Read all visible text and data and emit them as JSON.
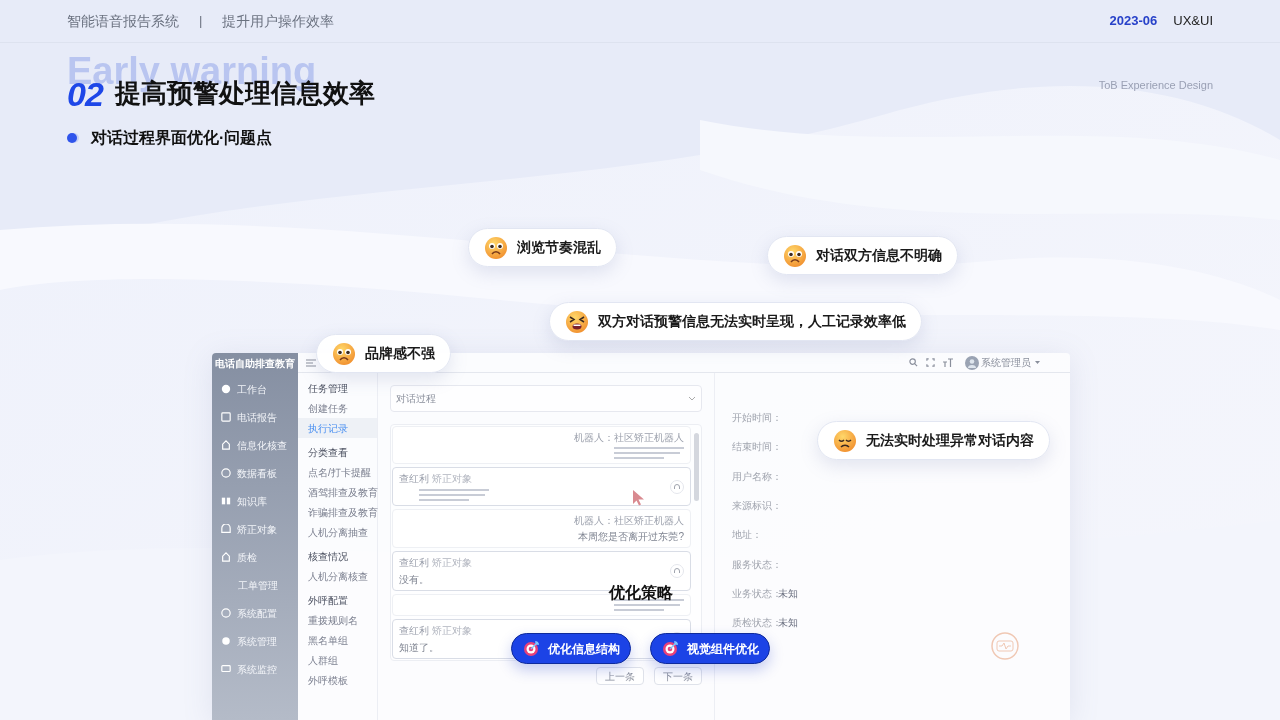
{
  "header": {
    "project": "智能语音报告系统",
    "separator": "|",
    "topic": "提升用户操作效率",
    "date": "2023-06",
    "tag": "UX&UI"
  },
  "section": {
    "number": "02",
    "ghost": "Early warning",
    "title": "提高预警处理信息效率",
    "subtitle": "对话过程界面优化·问题点",
    "tagline": "ToB Experience Design"
  },
  "app": {
    "brand": "电话自助排查教育",
    "sidebar": [
      {
        "label": "工作台",
        "selected": false
      },
      {
        "label": "电话报告",
        "selected": false
      },
      {
        "label": "信息化核查",
        "selected": false
      },
      {
        "label": "数据看板",
        "selected": false
      },
      {
        "label": "知识库",
        "selected": false
      },
      {
        "label": "矫正对象",
        "selected": false
      },
      {
        "label": "质检",
        "selected": false,
        "children": [
          {
            "label": "工单管理",
            "selected": false
          }
        ]
      },
      {
        "label": "系统配置",
        "selected": false
      },
      {
        "label": "系统管理",
        "selected": false
      },
      {
        "label": "系统监控",
        "selected": false
      }
    ],
    "submenu": [
      {
        "kind": "header",
        "label": "任务管理"
      },
      {
        "kind": "item",
        "label": "创建任务",
        "selected": false
      },
      {
        "kind": "item",
        "label": "执行记录",
        "selected": true
      },
      {
        "kind": "header",
        "label": "分类查看"
      },
      {
        "kind": "item",
        "label": "点名/打卡提醒",
        "selected": false
      },
      {
        "kind": "item",
        "label": "酒驾排查及教育",
        "selected": false
      },
      {
        "kind": "item",
        "label": "诈骗排查及教育",
        "selected": false
      },
      {
        "kind": "item",
        "label": "人机分离抽查",
        "selected": false
      },
      {
        "kind": "header",
        "label": "核查情况"
      },
      {
        "kind": "item",
        "label": "人机分离核查",
        "selected": false
      },
      {
        "kind": "header",
        "label": "外呼配置"
      },
      {
        "kind": "item",
        "label": "重拨规则名",
        "selected": false
      },
      {
        "kind": "item",
        "label": "黑名单组",
        "selected": false
      },
      {
        "kind": "item",
        "label": "人群组",
        "selected": false
      },
      {
        "kind": "item",
        "label": "外呼模板",
        "selected": false
      }
    ],
    "user": "系统管理员",
    "dropdown": "对话过程",
    "messages": [
      {
        "kind": "robot",
        "speaker": "机器人：社区矫正机器人",
        "illegible": true
      },
      {
        "kind": "user",
        "speaker": "查红利",
        "role": "矫正对象",
        "illegible": true
      },
      {
        "kind": "robot",
        "speaker": "机器人：社区矫正机器人",
        "text": "本周您是否离开过东莞?"
      },
      {
        "kind": "user",
        "speaker": "查红利",
        "role": "矫正对象",
        "text": "没有。"
      },
      {
        "kind": "robot",
        "illegible": true
      },
      {
        "kind": "user",
        "speaker": "查红利",
        "role": "矫正对象",
        "text": "知道了。"
      }
    ],
    "details": [
      {
        "label": "开始时间："
      },
      {
        "label": "结束时间："
      },
      {
        "label": "用户名称："
      },
      {
        "label": "来源标识："
      },
      {
        "label": "地址："
      },
      {
        "label": "服务状态："
      },
      {
        "label": "业务状态：",
        "value": "未知"
      },
      {
        "label": "质检状态：",
        "value": "未知"
      }
    ],
    "pager": [
      {
        "label": "上一条"
      },
      {
        "label": "下一条"
      }
    ]
  },
  "issues": [
    {
      "kind": "worried",
      "text": "浏览节奏混乱"
    },
    {
      "kind": "worried",
      "text": "对话双方信息不明确"
    },
    {
      "kind": "tired",
      "text": "双方对话预警信息无法实时呈现，人工记录效率低"
    },
    {
      "kind": "worried",
      "text": "品牌感不强"
    },
    {
      "kind": "sad",
      "text": "无法实时处理异常对话内容"
    }
  ],
  "strategy": {
    "title": "优化策略",
    "buttons": [
      "优化信息结构",
      "视觉组件优化"
    ]
  }
}
